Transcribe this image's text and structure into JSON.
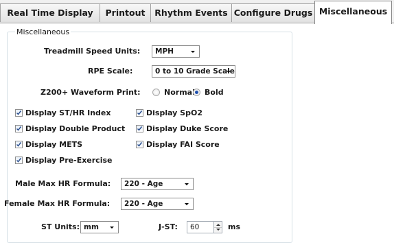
{
  "tabs": [
    {
      "label": "Real Time Display"
    },
    {
      "label": "Printout"
    },
    {
      "label": "Rhythm Events"
    },
    {
      "label": "Configure Drugs"
    },
    {
      "label": "Miscellaneous",
      "active": true
    }
  ],
  "group": {
    "title": "Miscellaneous"
  },
  "treadmill": {
    "label": "Treadmill Speed Units:",
    "value": "MPH"
  },
  "rpe": {
    "label": "RPE Scale:",
    "value": "0 to 10 Grade Scale"
  },
  "waveform": {
    "label": "Z200+ Waveform Print:",
    "options": [
      "Normal",
      "Bold"
    ],
    "selected": "Bold"
  },
  "checkboxes": [
    {
      "label": "Display ST/HR Index",
      "checked": true
    },
    {
      "label": "Display SpO2",
      "checked": true
    },
    {
      "label": "Display Double Product",
      "checked": true
    },
    {
      "label": "Display Duke Score",
      "checked": true
    },
    {
      "label": "Display METS",
      "checked": true
    },
    {
      "label": "Display FAI Score",
      "checked": true
    },
    {
      "label": "Display Pre-Exercise",
      "checked": true
    }
  ],
  "male_hr": {
    "label": "Male Max HR Formula:",
    "value": "220 - Age"
  },
  "female_hr": {
    "label": "Female Max HR Formula:",
    "value": "220 - Age"
  },
  "st_units": {
    "label": "ST Units:",
    "value": "mm"
  },
  "jst": {
    "label": "J-ST:",
    "value": "60",
    "unit": "ms"
  }
}
